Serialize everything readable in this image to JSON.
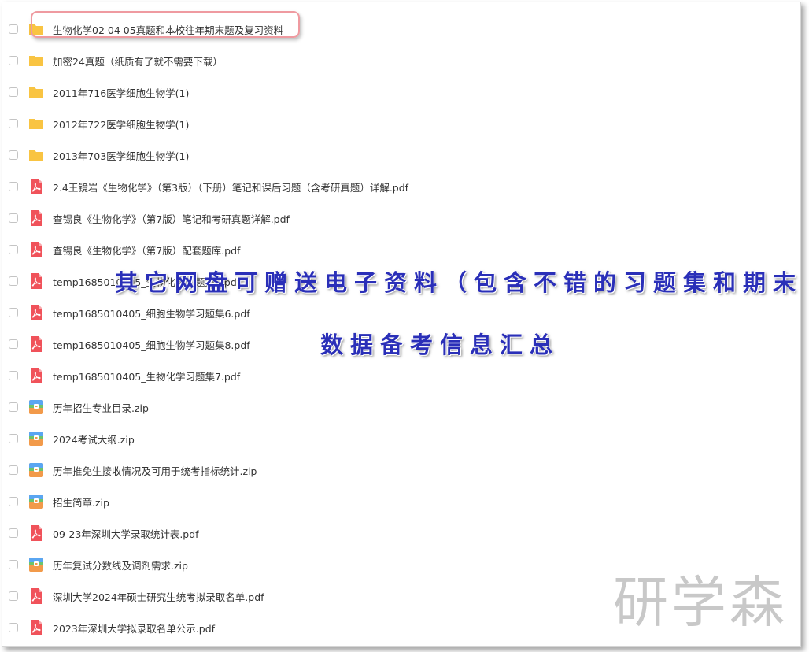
{
  "files": [
    {
      "name": "生物化学02 04 05真题和本校往年期末题及复习资料",
      "type": "folder",
      "icon": "folder-icon"
    },
    {
      "name": "加密24真题（纸质有了就不需要下载）",
      "type": "folder",
      "icon": "folder-icon"
    },
    {
      "name": "2011年716医学细胞生物学(1)",
      "type": "folder",
      "icon": "folder-icon"
    },
    {
      "name": "2012年722医学细胞生物学(1)",
      "type": "folder",
      "icon": "folder-icon"
    },
    {
      "name": "2013年703医学细胞生物学(1)",
      "type": "folder",
      "icon": "folder-icon"
    },
    {
      "name": "2.4王镜岩《生物化学》（第3版）（下册）笔记和课后习题（含考研真题）详解.pdf",
      "type": "pdf",
      "icon": "pdf-icon"
    },
    {
      "name": "查锡良《生物化学》（第7版）笔记和考研真题详解.pdf",
      "type": "pdf",
      "icon": "pdf-icon"
    },
    {
      "name": "查锡良《生物化学》（第7版）配套题库.pdf",
      "type": "pdf",
      "icon": "pdf-icon"
    },
    {
      "name": "temp1685010405_生物化学习题集5.pdf",
      "type": "pdf",
      "icon": "pdf-icon"
    },
    {
      "name": "temp1685010405_细胞生物学习题集6.pdf",
      "type": "pdf",
      "icon": "pdf-icon"
    },
    {
      "name": "temp1685010405_细胞生物学习题集8.pdf",
      "type": "pdf",
      "icon": "pdf-icon"
    },
    {
      "name": "temp1685010405_生物化学习题集7.pdf",
      "type": "pdf",
      "icon": "pdf-icon"
    },
    {
      "name": "历年招生专业目录.zip",
      "type": "zip",
      "icon": "zip-icon"
    },
    {
      "name": "2024考试大纲.zip",
      "type": "zip",
      "icon": "zip-icon"
    },
    {
      "name": "历年推免生接收情况及可用于统考指标统计.zip",
      "type": "zip",
      "icon": "zip-icon"
    },
    {
      "name": "招生简章.zip",
      "type": "zip",
      "icon": "zip-icon"
    },
    {
      "name": "09-23年深圳大学录取统计表.pdf",
      "type": "pdf",
      "icon": "pdf-icon"
    },
    {
      "name": "历年复试分数线及调剂需求.zip",
      "type": "zip",
      "icon": "zip-icon"
    },
    {
      "name": "深圳大学2024年硕士研究生统考拟录取名单.pdf",
      "type": "pdf",
      "icon": "pdf-icon"
    },
    {
      "name": "2023年深圳大学拟录取名单公示.pdf",
      "type": "pdf",
      "icon": "pdf-icon"
    }
  ],
  "overlay": {
    "line1": "其它网盘可赠送电子资料（包含不错的习题集和期末题等）",
    "line2": "数据备考信息汇总"
  },
  "watermark": "研学森",
  "colors": {
    "folder": "#f8c443",
    "pdf": "#f0525a",
    "zip_top": "#5aa6f2",
    "zip_bottom": "#f29a4a",
    "zip_mid": "#6bc46d",
    "highlight": "#ef9aa0",
    "overlay_text": "#2a2fb8"
  }
}
